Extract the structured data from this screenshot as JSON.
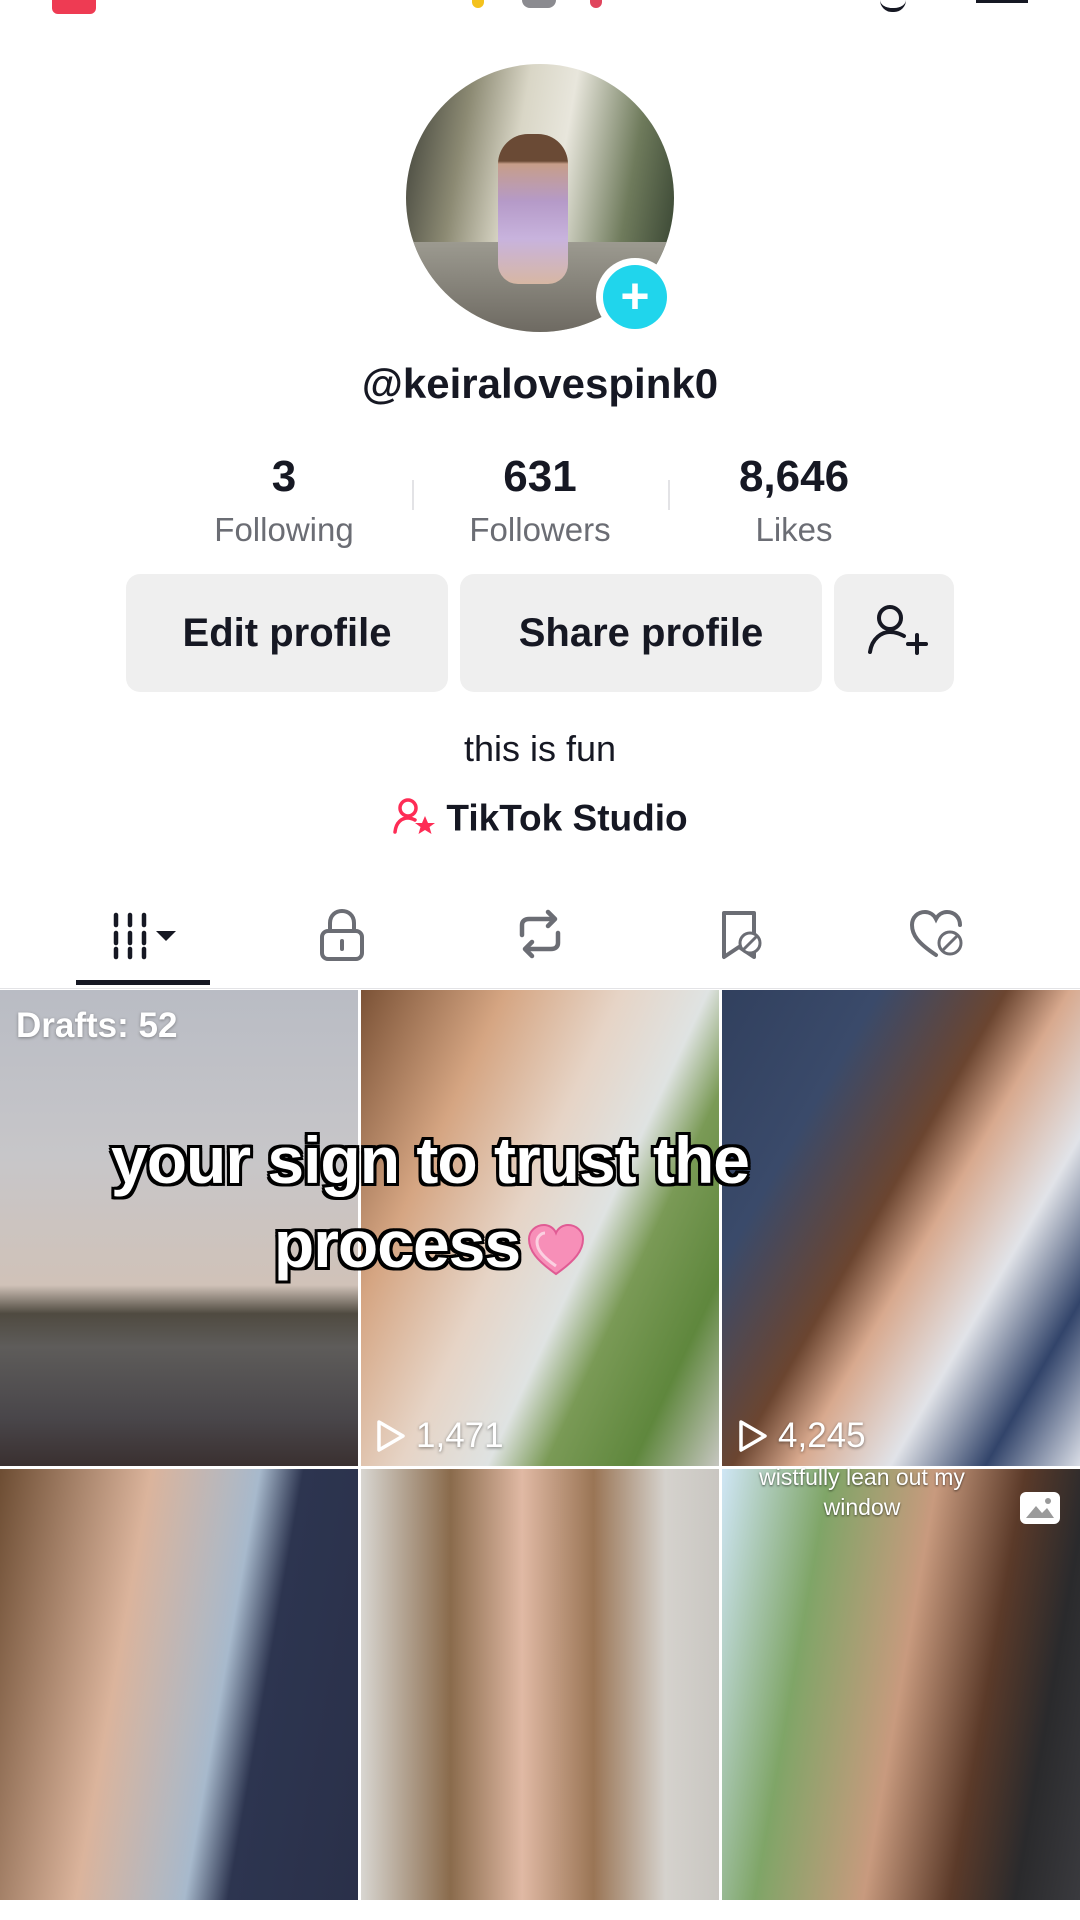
{
  "profile": {
    "username": "@keiralovespink0",
    "stats": {
      "following": {
        "value": "3",
        "label": "Following"
      },
      "followers": {
        "value": "631",
        "label": "Followers"
      },
      "likes": {
        "value": "8,646",
        "label": "Likes"
      }
    },
    "edit_button": "Edit profile",
    "share_button": "Share profile",
    "bio": "this is fun",
    "studio_link": "TikTok Studio"
  },
  "tabs": [
    {
      "icon": "grid-icon",
      "selected": true
    },
    {
      "icon": "lock-icon"
    },
    {
      "icon": "repost-icon"
    },
    {
      "icon": "bookmark-hidden-icon"
    },
    {
      "icon": "heart-hidden-icon"
    }
  ],
  "grid": {
    "drafts_label": "Drafts: 52",
    "overlay_text_line1": "your sign to trust the",
    "overlay_text_line2": "process",
    "overlay_emoji": "pink-heart",
    "videos": [
      {
        "views": "1,471"
      },
      {
        "views": "4,245"
      }
    ],
    "caption_line1": "wistfully lean out my",
    "caption_line2": "window"
  },
  "colors": {
    "accent": "#20d5ec",
    "text": "#161823",
    "secondary_text": "#6b6d74",
    "button_bg": "#efefef",
    "studio_icon": "#fe2c55"
  }
}
